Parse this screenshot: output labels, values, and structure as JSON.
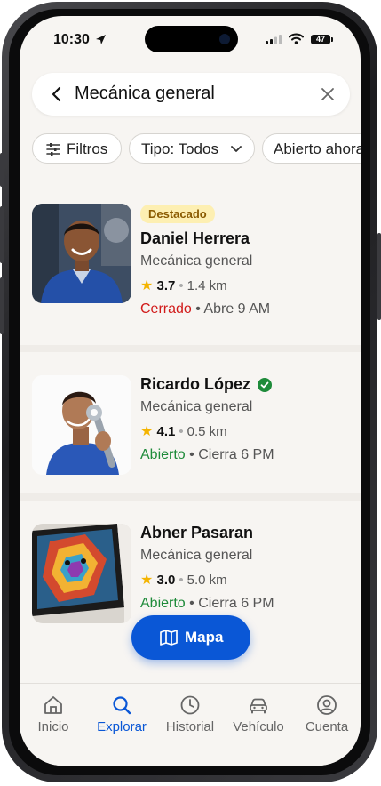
{
  "status": {
    "time": "10:30",
    "battery": "47"
  },
  "search": {
    "query": "Mecánica general"
  },
  "filters": [
    {
      "label": "Filtros",
      "icon": "sliders-icon"
    },
    {
      "label": "Tipo: Todos",
      "icon": "chevron-down-icon"
    },
    {
      "label": "Abierto ahora"
    }
  ],
  "results": [
    {
      "badge": "Destacado",
      "name": "Daniel Herrera",
      "category": "Mecánica general",
      "rating": "3.7",
      "distance": "1.4 km",
      "status": "Cerrado",
      "hours": "Abre 9 AM",
      "verified": false
    },
    {
      "name": "Ricardo López",
      "category": "Mecánica general",
      "rating": "4.1",
      "distance": "0.5 km",
      "status": "Abierto",
      "hours": "Cierra 6 PM",
      "verified": true
    },
    {
      "name": "Abner Pasaran",
      "category": "Mecánica general",
      "rating": "3.0",
      "distance": "5.0 km",
      "status": "Abierto",
      "hours": "Cierra 6 PM",
      "verified": false
    }
  ],
  "map_button": {
    "label": "Mapa"
  },
  "tabs": [
    {
      "label": "Inicio",
      "icon": "home-icon"
    },
    {
      "label": "Explorar",
      "icon": "search-icon",
      "active": true
    },
    {
      "label": "Historial",
      "icon": "clock-icon"
    },
    {
      "label": "Vehículo",
      "icon": "car-icon"
    },
    {
      "label": "Cuenta",
      "icon": "user-circle-icon"
    }
  ],
  "colors": {
    "accent": "#0a57d6",
    "open": "#1e8b3a",
    "closed": "#d11a1a",
    "star": "#f4b400",
    "badge_bg": "#fdefb2"
  }
}
